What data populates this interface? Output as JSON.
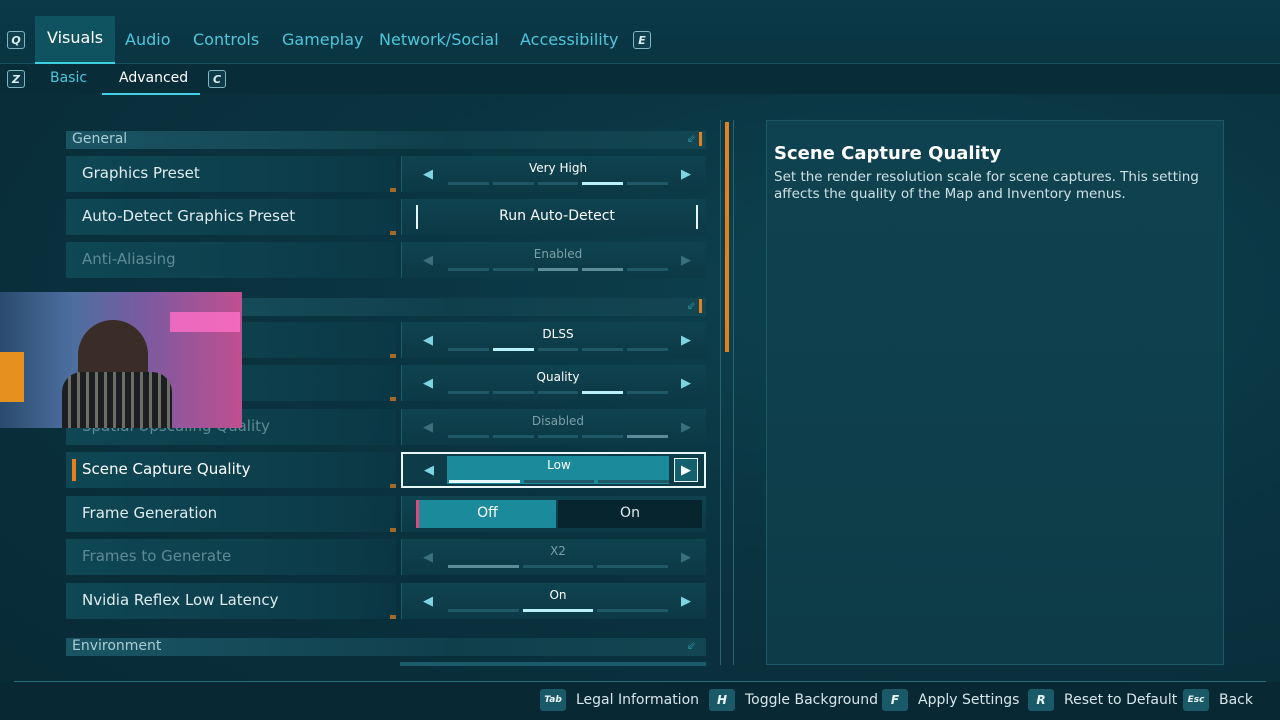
{
  "tabs": {
    "left_key": "Q",
    "right_key": "E",
    "items": [
      "Visuals",
      "Audio",
      "Controls",
      "Gameplay",
      "Network/Social",
      "Accessibility"
    ]
  },
  "subtabs": {
    "left_key": "Z",
    "right_key": "C",
    "items": [
      "Basic",
      "Advanced"
    ]
  },
  "sections": {
    "general": "General",
    "hidden": "",
    "environment": "Environment"
  },
  "settings": {
    "graphics_preset": {
      "label": "Graphics Preset",
      "value": "Very High",
      "level": 0.8
    },
    "auto_detect": {
      "label": "Auto-Detect Graphics Preset",
      "button": "Run Auto-Detect"
    },
    "anti_aliasing": {
      "label": "Anti-Aliasing",
      "value": "Enabled",
      "level": 1.0
    },
    "upscaling": {
      "label": "",
      "value": "DLSS",
      "level": 0.4
    },
    "upscaling_quality": {
      "label": "",
      "value": "Quality",
      "level": 0.8
    },
    "spatial_upscaling_quality": {
      "label": "Spatial Upscaling Quality",
      "value": "Disabled",
      "level": 1.0
    },
    "scene_capture_quality": {
      "label": "Scene Capture Quality",
      "value": "Low",
      "level": 0.33
    },
    "frame_generation": {
      "label": "Frame Generation",
      "off": "Off",
      "on": "On",
      "selected": "Off"
    },
    "frames_to_generate": {
      "label": "Frames to Generate",
      "value": "X2",
      "level": 0.33
    },
    "nvidia_reflex": {
      "label": "Nvidia Reflex Low Latency",
      "value": "On",
      "level": 0.5
    }
  },
  "panel": {
    "title": "Scene Capture Quality",
    "description": "Set the render resolution scale for scene captures. This setting affects the quality of the Map and Inventory menus."
  },
  "footer": [
    {
      "key": "Tab",
      "label": "Legal Information"
    },
    {
      "key": "H",
      "label": "Toggle Background"
    },
    {
      "key": "F",
      "label": "Apply Settings"
    },
    {
      "key": "R",
      "label": "Reset to Default"
    },
    {
      "key": "Esc",
      "label": "Back"
    }
  ],
  "colors": {
    "accent_orange": "#e6801f",
    "accent_cyan": "#3fd0e6",
    "selected_fill": "#1b8a9b"
  }
}
